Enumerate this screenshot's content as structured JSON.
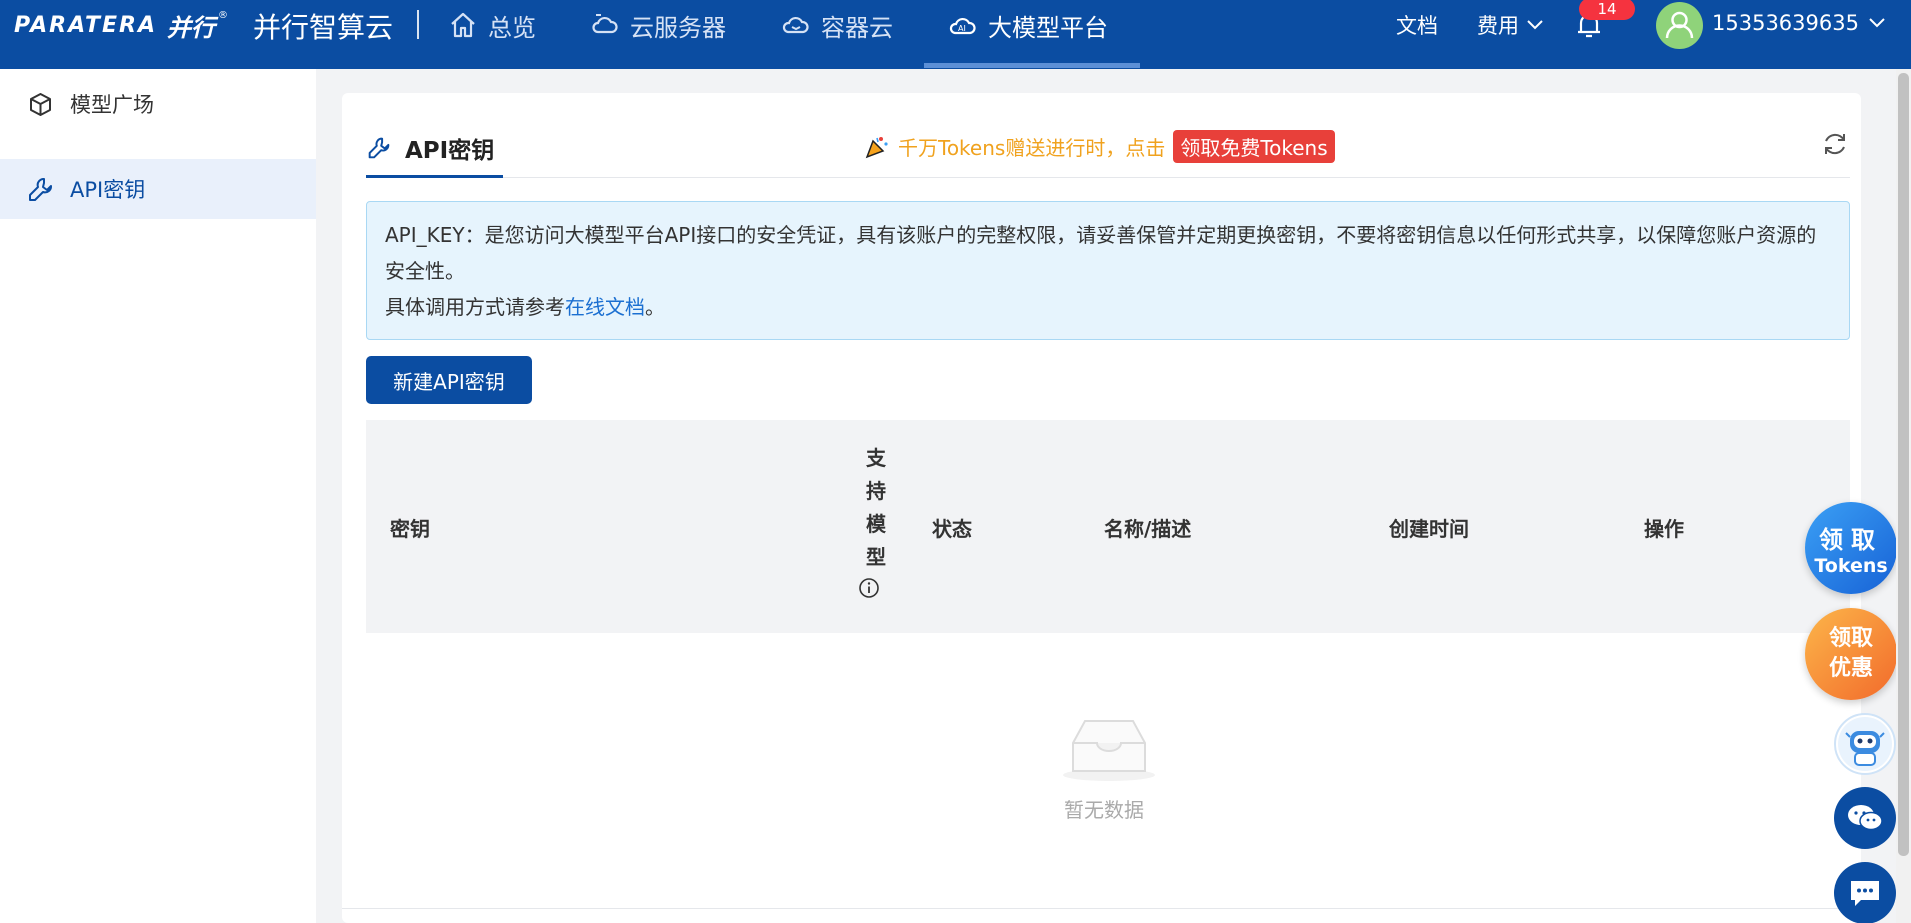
{
  "header": {
    "logo_en": "PARATERA",
    "logo_cn": "并行",
    "logo_reg": "®",
    "brand": "并行智算云",
    "nav": [
      {
        "label": "总览",
        "icon": "home-icon"
      },
      {
        "label": "云服务器",
        "icon": "cloud-server-icon"
      },
      {
        "label": "容器云",
        "icon": "container-cloud-icon"
      },
      {
        "label": "大模型平台",
        "icon": "ai-cloud-icon",
        "active": true
      }
    ],
    "docs": "文档",
    "fees": "费用",
    "notification_count": "14",
    "username": "15353639635"
  },
  "sidebar": {
    "items": [
      {
        "label": "模型广场",
        "icon": "cube-icon"
      },
      {
        "label": "API密钥",
        "icon": "wrench-icon",
        "active": true
      }
    ]
  },
  "main": {
    "tab_title": "API密钥",
    "promo_text": "千万Tokens赠送进行时，点击",
    "promo_button": "领取免费Tokens",
    "notice_line1": "API_KEY：是您访问大模型平台API接口的安全凭证，具有该账户的完整权限，请妥善保管并定期更换密钥，不要将密钥信息以任何形式共享，以保障您账户资源的安全性。",
    "notice_line2_prefix": "具体调用方式请参考",
    "notice_link": "在线文档",
    "notice_line2_suffix": "。",
    "new_button": "新建API密钥",
    "table": {
      "columns": {
        "key": "密钥",
        "supported_models": [
          "支",
          "持",
          "模",
          "型"
        ],
        "status": "状态",
        "name_desc": "名称/描述",
        "created_at": "创建时间",
        "actions": "操作"
      },
      "empty_text": "暂无数据"
    }
  },
  "floating": {
    "tokens_line1": "领取",
    "tokens_line2": "Tokens",
    "offer_line1": "领取",
    "offer_line2": "优惠"
  },
  "colors": {
    "primary": "#0b4da2",
    "promo": "#f0a21e",
    "promo_button": "#e8403a",
    "badge": "#f5333f"
  }
}
